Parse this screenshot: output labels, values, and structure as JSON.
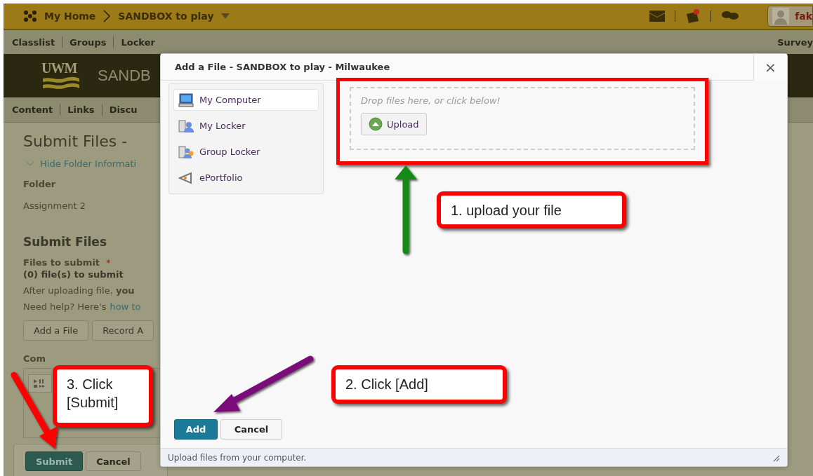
{
  "top_bar": {
    "home": "My Home",
    "course": "SANDBOX to play",
    "user": "fak"
  },
  "nav_bar": {
    "items": [
      "Classlist",
      "Groups",
      "Locker"
    ],
    "right": "Survey"
  },
  "banner": {
    "logo": "UWM",
    "title": "SANDB"
  },
  "course_nav": {
    "items": [
      "Content",
      "Links",
      "Discu"
    ]
  },
  "page": {
    "title": "Submit Files -",
    "toggle": "Hide Folder Informati",
    "folder_label": "Folder",
    "folder_name": "Assignment 2",
    "section": "Submit Files",
    "files_label": "Files to submit",
    "required": "*",
    "file_count": "(0) file(s) to submit",
    "note": "After uploading file, **you**",
    "help_text": "Need help? Here's",
    "help_link": "how to",
    "buttons": [
      "Add a File",
      "Record A"
    ],
    "comments_label": "Com",
    "submit": "Submit",
    "cancel": "Cancel"
  },
  "dialog": {
    "title": "Add a File - SANDBOX to play - Milwaukee",
    "close": "×",
    "sources": [
      {
        "label": "My Computer",
        "kind": "computer",
        "selected": true
      },
      {
        "label": "My Locker",
        "kind": "locker",
        "selected": false
      },
      {
        "label": "Group Locker",
        "kind": "group",
        "selected": false
      },
      {
        "label": "ePortfolio",
        "kind": "portfolio",
        "selected": false
      }
    ],
    "drop_hint": "Drop files here, or click below!",
    "upload": "Upload",
    "add": "Add",
    "cancel": "Cancel",
    "status": "Upload files from your computer."
  },
  "callouts": [
    {
      "text": "1. upload your file",
      "kind": "upload"
    },
    {
      "text": "2. Click [Add]",
      "kind": "add"
    },
    {
      "text": "3. Click [Submit]",
      "kind": "submit"
    }
  ]
}
